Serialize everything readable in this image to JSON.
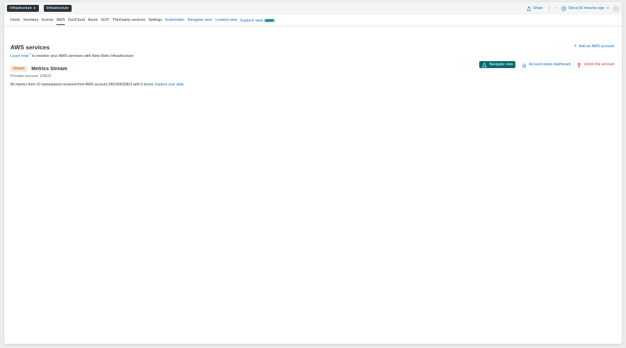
{
  "topbar": {
    "app_dropdown": "Infrastructure",
    "breadcrumb": "Infrastructure",
    "share_label": "Share",
    "time_range": "Since 60 minutes ago"
  },
  "tabs": [
    {
      "label": "Hosts"
    },
    {
      "label": "Inventory"
    },
    {
      "label": "Events"
    },
    {
      "label": "AWS"
    },
    {
      "label": "GovCloud"
    },
    {
      "label": "Azure"
    },
    {
      "label": "GCP"
    },
    {
      "label": "Third-party services"
    },
    {
      "label": "Settings"
    },
    {
      "label": "Kubernetes"
    },
    {
      "label": "Navigator view"
    },
    {
      "label": "Lookout view"
    },
    {
      "label": "Explorer view",
      "badge": "NEW"
    }
  ],
  "main": {
    "title": "AWS services",
    "learn_link": "Learn how",
    "subtitle_rest": " to monitor your AWS services with New Relic Infrastructure",
    "add_account": "Add an AWS account",
    "stream_badge": "Stream",
    "account_title": "Metrics Stream",
    "navigator_button": "Navigator view",
    "status_dashboard": "Account status dashboard",
    "unlink": "Unlink this account",
    "provider_account": "Provider account: 109221",
    "summary_text": "80 metrics from 10 namespaces received from AWS account 290140632813 with 0 errors. ",
    "explore_link": "Explore your data."
  },
  "colors": {
    "accent": "#0b6acb",
    "dark": "#293338",
    "teal": "#006b70",
    "danger": "#df2d24"
  }
}
